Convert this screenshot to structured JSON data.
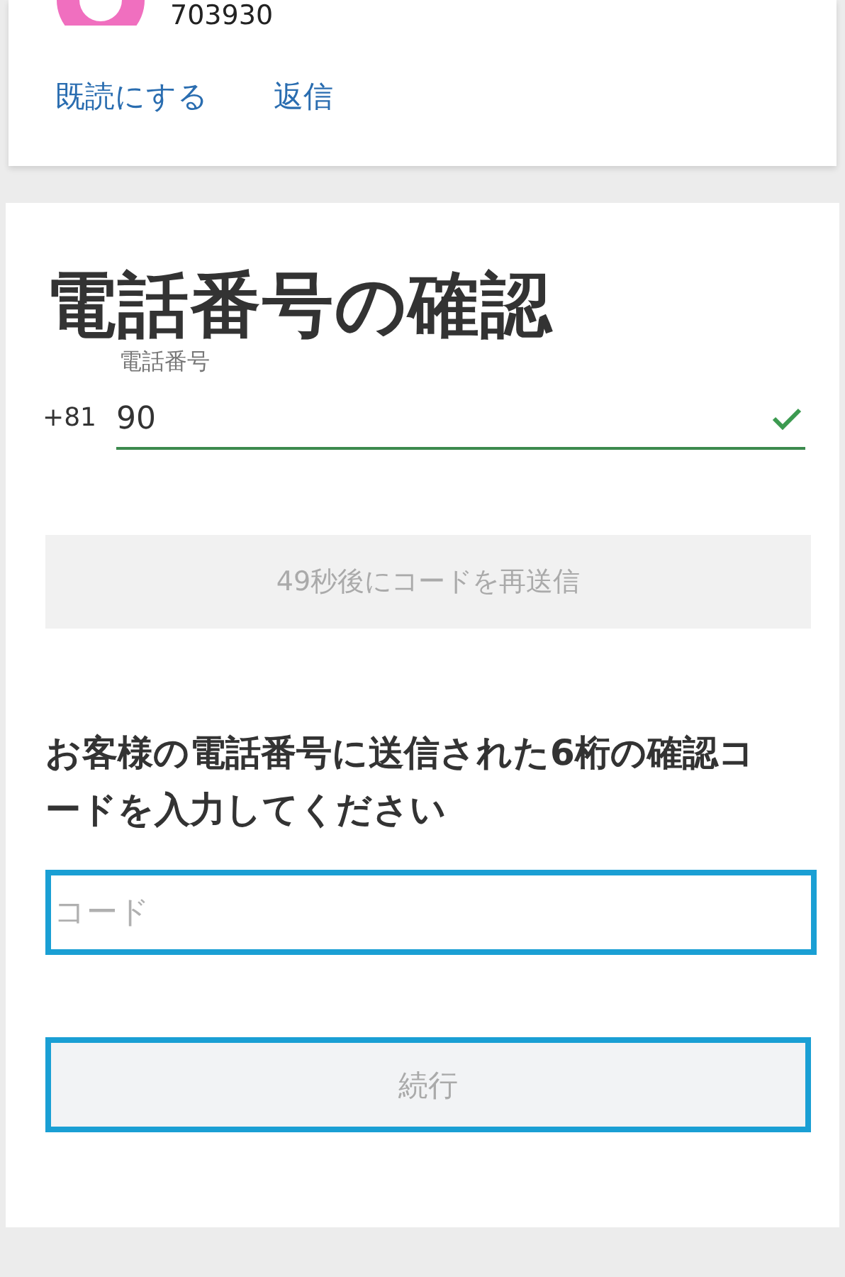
{
  "message_card": {
    "sender_code": "703930",
    "actions": [
      "既読にする",
      "返信"
    ]
  },
  "verify": {
    "title": "電話番号の確認",
    "phone": {
      "label": "電話番号",
      "country_code": "+81",
      "value": "90",
      "valid": true
    },
    "resend": {
      "label": "49秒後にコードを再送信",
      "disabled": true
    },
    "instruction": "お客様の電話番号に送信された6桁の確認コードを入力してください",
    "code_field": {
      "placeholder": "コード"
    },
    "continue": {
      "label": "続行",
      "disabled": true
    }
  }
}
